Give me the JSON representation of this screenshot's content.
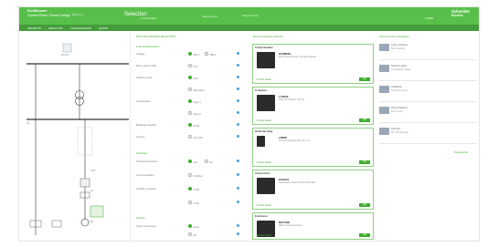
{
  "header": {
    "brand_line1": "EcoStruxure",
    "brand_line2": "Control Panel / Power Design",
    "version": "Beta 9.2.1",
    "page_title": "Selection",
    "page_subtitle": "of the project",
    "project_select": "Select project",
    "country_select": "Select country",
    "user_label": "LOGIN",
    "logo_line1": "Schneider",
    "logo_line2": "Electric"
  },
  "nav": [
    "PROJECTS",
    "SELECTION",
    "CONFIGURATION",
    "QUOTE"
  ],
  "diagram": {
    "device_label": "MCCB",
    "labels": [
      "Q1",
      "KM1",
      "F1",
      "M1"
    ]
  },
  "form": {
    "title": "MOTOR STARTER SELECTION",
    "sub1": "Load characteristics",
    "rows1": [
      {
        "label": "Voltage",
        "opt1": "400 V",
        "opt2": "690 V"
      },
      {
        "label": "Motor power (kW)",
        "opt1": "0.37",
        "opt2": ""
      },
      {
        "label": "Starting mode",
        "opt1": "DOL",
        "opt2": ""
      },
      {
        "label": "",
        "opt1": "Star-delta",
        "opt2": ""
      },
      {
        "label": "Coordination",
        "opt1": "Type 1",
        "opt2": ""
      },
      {
        "label": "",
        "opt1": "Type 2",
        "opt2": ""
      },
      {
        "label": "Breaking capacity",
        "opt1": "50 kA",
        "opt2": ""
      },
      {
        "label": "Control",
        "opt1": "24 V DC",
        "opt2": ""
      }
    ],
    "sub2": "Protection",
    "rows2": [
      {
        "label": "Thermal protection",
        "opt1": "Yes",
        "opt2": "No"
      },
      {
        "label": "Communication",
        "opt1": "Modbus",
        "opt2": ""
      },
      {
        "label": "Auxiliary contacts",
        "opt1": "1 NO",
        "opt2": ""
      },
      {
        "label": "",
        "opt1": "1 NC",
        "opt2": ""
      }
    ],
    "sub3": "Options",
    "rows3": [
      {
        "label": "Surge suppressor",
        "opt1": "None",
        "opt2": ""
      },
      {
        "label": "",
        "opt1": "RC",
        "opt2": ""
      }
    ]
  },
  "products": {
    "title": "Recommended products",
    "cards": [
      {
        "head": "Circuit breaker",
        "name": "GV2ME08",
        "desc": "Motor circuit breaker, thermal magnetic",
        "link": "Product details",
        "btn": "Add"
      },
      {
        "head": "Contactor",
        "name": "LC1D09",
        "desc": "TeSys D contactor, 3P, 9 A",
        "link": "Product details",
        "btn": "Add"
      },
      {
        "head": "Overload relay",
        "name": "LRD08",
        "desc": "Thermal overload relay 2.5...4 A",
        "link": "Product details",
        "btn": "Add"
      },
      {
        "head": "Accessories",
        "name": "GV2AF3",
        "desc": "Combination block for GV2 and LC1D",
        "link": "Product details",
        "btn": "Add"
      },
      {
        "head": "Enclosure",
        "name": "NSYCRN",
        "desc": "Wall mounting enclosure",
        "link": "Product details",
        "btn": "Add"
      }
    ]
  },
  "side": {
    "title": "Technical documentation",
    "rows": [
      {
        "t1": "TeSys catalogue",
        "t2": "Motor starters"
      },
      {
        "t1": "Selection guide",
        "t2": "Coordination tables"
      },
      {
        "t1": "Installation",
        "t2": "Instruction sheet"
      },
      {
        "t1": "Wiring diagrams",
        "t2": "DOL starter"
      },
      {
        "t1": "CAD files",
        "t2": "2D / 3D drawings"
      }
    ],
    "footer": "Download all"
  },
  "colors": {
    "accent": "#3dae2b",
    "header": "#58c04a",
    "nav": "#449c3b"
  }
}
